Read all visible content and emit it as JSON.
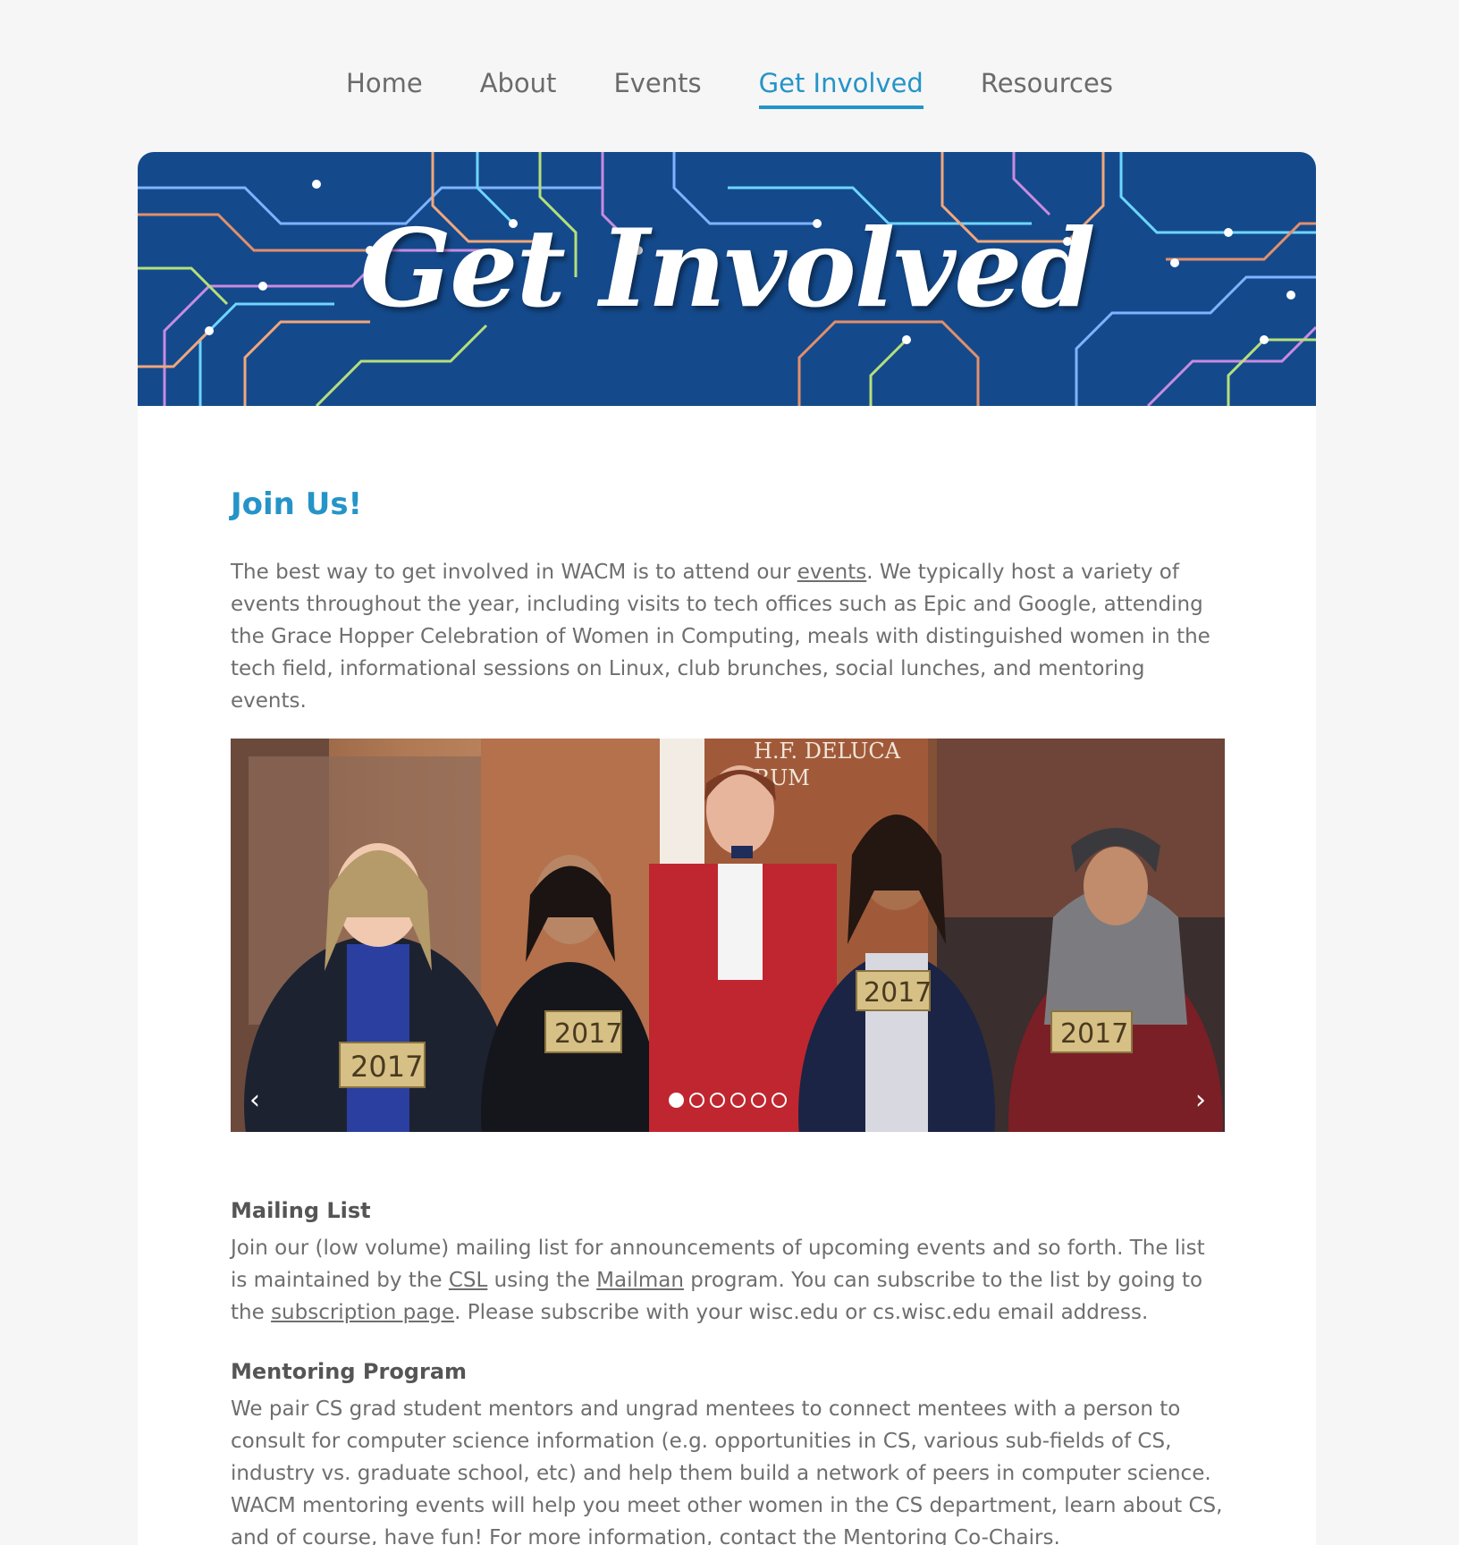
{
  "nav": {
    "items": [
      {
        "label": "Home",
        "active": false
      },
      {
        "label": "About",
        "active": false
      },
      {
        "label": "Events",
        "active": false
      },
      {
        "label": "Get Involved",
        "active": true
      },
      {
        "label": "Resources",
        "active": false
      }
    ]
  },
  "banner": {
    "title": "Get Involved"
  },
  "join": {
    "heading": "Join Us!",
    "text_before": "The best way to get involved in WACM is to attend our ",
    "events_link": "events",
    "text_after": ". We typically host a variety of events throughout the year, including visits to tech offices such as Epic and Google, attending the Grace Hopper Celebration of Women in Computing, meals with distinguished women in the tech field, informational sessions on Linux, club brunches, social lunches, and mentoring events."
  },
  "carousel": {
    "prev_label": "‹",
    "next_label": "›",
    "slide_count": 6,
    "active_slide": 1,
    "sign_text": "H.F. DELUCA\nFORUM",
    "sign_line1": "H.F. DELUCA",
    "sign_line2": "RUM",
    "brick_label": "2017"
  },
  "mailing": {
    "heading": "Mailing List",
    "t1": "Join our (low volume) mailing list for announcements of upcoming events and so forth. The list is maintained by the ",
    "csl_link": "CSL",
    "t2": " using the ",
    "mailman_link": "Mailman",
    "t3": " program. You can subscribe to the list by going to the ",
    "subscription_link": "subscription page",
    "t4": ". Please subscribe with your wisc.edu or cs.wisc.edu email address."
  },
  "mentoring": {
    "heading": "Mentoring Program",
    "t1": "We pair CS grad student mentors and ungrad mentees to connect mentees with a person to consult for computer science information (e.g. opportunities in CS, various sub-fields of CS, industry vs. graduate school, etc) and help them build a network of peers in computer science. WACM mentoring events will help you meet other women in the CS department, learn about CS, and of course, have fun! For more information, contact the ",
    "cochairs_link": "Mentoring Co-Chairs",
    "t2": "."
  },
  "colors": {
    "accent": "#2594c8",
    "banner_bg": "#144a8c"
  }
}
